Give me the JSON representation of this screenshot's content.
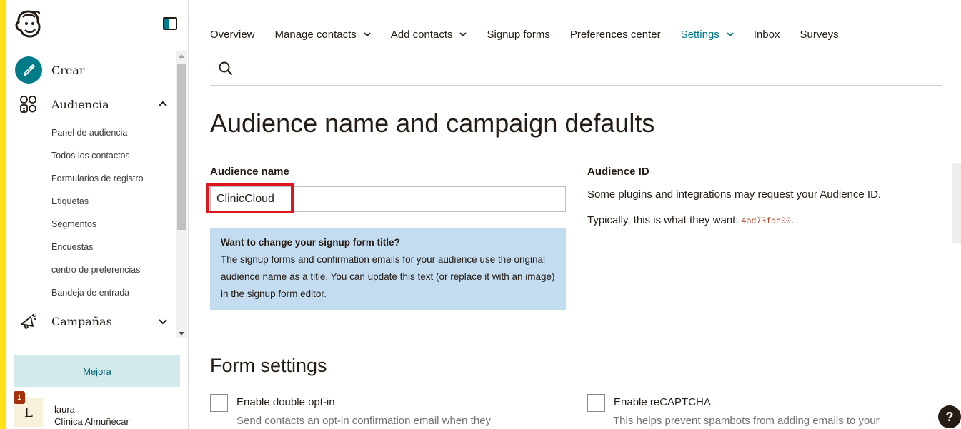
{
  "sidebar": {
    "create_label": "Crear",
    "audience_label": "Audiencia",
    "audience_items": [
      "Panel de audiencia",
      "Todos los contactos",
      "Formularios de registro",
      "Etiquetas",
      "Segmentos",
      "Encuestas",
      "centro de preferencias",
      "Bandeja de entrada"
    ],
    "campaigns_label": "Campañas",
    "upgrade_label": "Mejora",
    "user": {
      "initial": "L",
      "notification_count": "1",
      "name": "laura",
      "organization": "Clínica Almuñécar"
    }
  },
  "topnav": {
    "tabs": [
      {
        "label": "Overview"
      },
      {
        "label": "Manage contacts"
      },
      {
        "label": "Add contacts"
      },
      {
        "label": "Signup forms"
      },
      {
        "label": "Preferences center"
      },
      {
        "label": "Settings"
      },
      {
        "label": "Inbox"
      },
      {
        "label": "Surveys"
      }
    ],
    "active_tab": "Settings"
  },
  "page": {
    "title": "Audience name and campaign defaults",
    "audience_name": {
      "label": "Audience name",
      "value": "ClinicCloud"
    },
    "info_box": {
      "title": "Want to change your signup form title?",
      "body": "The signup forms and confirmation emails for your audience use the original audience name as a title. You can update this text (or replace it with an image) in the",
      "link": "signup form editor",
      "end": "."
    },
    "audience_id": {
      "label": "Audience ID",
      "line1": "Some plugins and integrations may request your Audience ID.",
      "line2_prefix": "Typically, this is what they want: ",
      "id_value": "4ad73fae00",
      "line2_suffix": "."
    },
    "form_settings": {
      "title": "Form settings",
      "double_optin": {
        "label": "Enable double opt-in",
        "description": "Send contacts an opt-in confirmation email when they"
      },
      "recaptcha": {
        "label": "Enable reCAPTCHA",
        "description": "This helps prevent spambots from adding emails to your"
      }
    }
  },
  "help_label": "?",
  "colors": {
    "accent_yellow": "#ffe01b",
    "brand_teal": "#007c89",
    "highlight_red": "#e0161e",
    "info_blue": "#c4dcf0"
  }
}
